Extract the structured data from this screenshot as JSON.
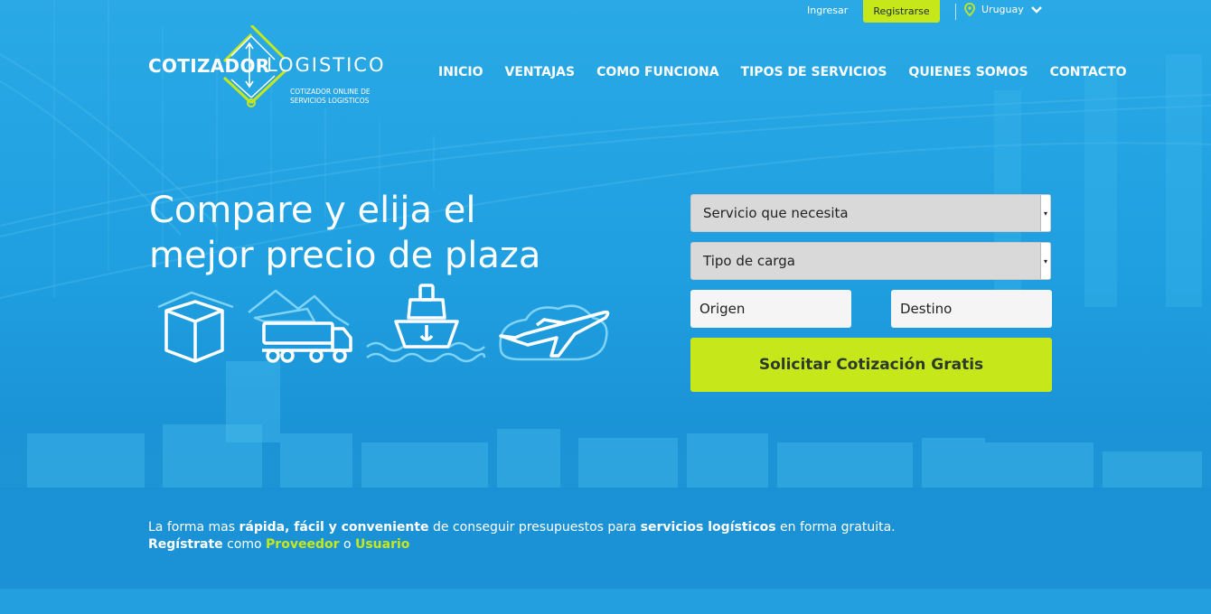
{
  "topbar": {
    "login_label": "Ingresar",
    "register_label": "Registrarse",
    "country": "Uruguay"
  },
  "logo": {
    "word1": "COTIZADOR",
    "word2": "LOGISTICO",
    "subtitle_line1": "COTIZADOR ONLINE DE",
    "subtitle_line2": "SERVICIOS LOGISTICOS"
  },
  "nav": {
    "items": [
      {
        "label": "INICIO"
      },
      {
        "label": "VENTAJAS"
      },
      {
        "label": "COMO FUNCIONA"
      },
      {
        "label": "TIPOS DE SERVICIOS"
      },
      {
        "label": "QUIENES SOMOS"
      },
      {
        "label": "CONTACTO"
      }
    ]
  },
  "hero": {
    "headline_line1": "Compare y elija el",
    "headline_line2": "mejor precio de plaza",
    "icons": [
      "box-icon",
      "truck-icon",
      "ship-icon",
      "plane-icon"
    ]
  },
  "form": {
    "service_select": "Servicio que necesita",
    "cargo_select": "Tipo de carga",
    "origin_placeholder": "Origen",
    "destination_placeholder": "Destino",
    "submit_label": "Solicitar Cotización Gratis"
  },
  "tagline": {
    "p1": "La forma mas ",
    "b1": "rápida, fácil y conveniente",
    "p2": " de conseguir presupuestos para ",
    "b2": "servicios logísticos",
    "p3": " en forma gratuita.",
    "register_word": "Regístrate",
    "p4": " como ",
    "provider": "Proveedor",
    "p5": " o ",
    "user": "Usuario"
  },
  "colors": {
    "background": "#1f9fe0",
    "accent": "#c6e81a",
    "text": "#ffffff",
    "field": "#d9d9d9"
  }
}
